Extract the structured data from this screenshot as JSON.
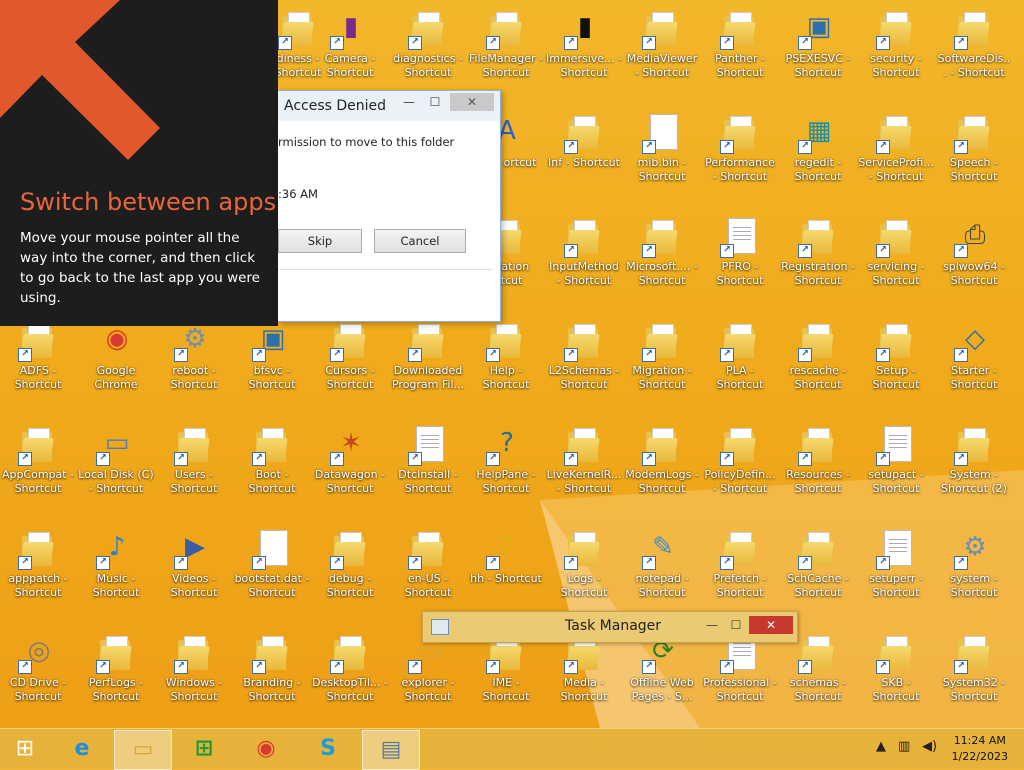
{
  "tip": {
    "title": "Switch between apps",
    "body": "Move your mouse pointer all the way into the corner, and then click to go back to the last app you were using."
  },
  "dialog": {
    "title": "Access Denied",
    "message": "rmission to move to this folder",
    "time": ":36 AM",
    "skip_label": "Skip",
    "cancel_label": "Cancel",
    "min_glyph": "—",
    "max_glyph": "☐",
    "close_glyph": "✕"
  },
  "taskmgr": {
    "title": "Task Manager",
    "min_glyph": "—",
    "max_glyph": "☐",
    "close_glyph": "✕"
  },
  "desktop_icons": [
    {
      "label": "diness - Shortcut",
      "kind": "folder"
    },
    {
      "label": "Camera - Shortcut",
      "kind": "purpledoc"
    },
    {
      "label": "diagnostics - Shortcut",
      "kind": "folder"
    },
    {
      "label": "FileManager - Shortcut",
      "kind": "folder"
    },
    {
      "label": "Immersive... - Shortcut",
      "kind": "blackdoc"
    },
    {
      "label": "MediaViewer - Shortcut",
      "kind": "folder"
    },
    {
      "label": "Panther - Shortcut",
      "kind": "folder"
    },
    {
      "label": "PSEXESVC - Shortcut",
      "kind": "window"
    },
    {
      "label": "security - Shortcut",
      "kind": "folder"
    },
    {
      "label": "SoftwareDis... - Shortcut",
      "kind": "folder"
    },
    {
      "label": "nts - ortcut",
      "kind": "font"
    },
    {
      "label": "Inf - Shortcut",
      "kind": "folder"
    },
    {
      "label": "mib.bin - Shortcut",
      "kind": "doc"
    },
    {
      "label": "Performance - Shortcut",
      "kind": "folder"
    },
    {
      "label": "regedit - Shortcut",
      "kind": "regedit"
    },
    {
      "label": "ServiceProfi... - Shortcut",
      "kind": "folder"
    },
    {
      "label": "Speech - Shortcut",
      "kind": "folder"
    },
    {
      "label": "alization ortcut",
      "kind": "folder"
    },
    {
      "label": "InputMethod - Shortcut",
      "kind": "folder"
    },
    {
      "label": "Microsoft.... - Shortcut",
      "kind": "folder"
    },
    {
      "label": "PFRO - Shortcut",
      "kind": "textdoc"
    },
    {
      "label": "Registration - Shortcut",
      "kind": "folder"
    },
    {
      "label": "servicing - Shortcut",
      "kind": "folder"
    },
    {
      "label": "splwow64 - Shortcut",
      "kind": "printer"
    },
    {
      "label": "ADFS - Shortcut",
      "kind": "folder"
    },
    {
      "label": "Google Chrome",
      "kind": "chrome"
    },
    {
      "label": "reboot - Shortcut",
      "kind": "gear"
    },
    {
      "label": "bfsvc - Shortcut",
      "kind": "window"
    },
    {
      "label": "Cursors - Shortcut",
      "kind": "folder"
    },
    {
      "label": "Downloaded Program Fil...",
      "kind": "folder"
    },
    {
      "label": "Help - Shortcut",
      "kind": "folder"
    },
    {
      "label": "L2Schemas - Shortcut",
      "kind": "folder"
    },
    {
      "label": "Migration - Shortcut",
      "kind": "folder"
    },
    {
      "label": "PLA - Shortcut",
      "kind": "folder"
    },
    {
      "label": "rescache - Shortcut",
      "kind": "folder"
    },
    {
      "label": "Setup - Shortcut",
      "kind": "folder"
    },
    {
      "label": "Starter - Shortcut",
      "kind": "xmldoc"
    },
    {
      "label": "AppCompat - Shortcut",
      "kind": "folder"
    },
    {
      "label": "Local Disk (C) - Shortcut",
      "kind": "drive"
    },
    {
      "label": "Users - Shortcut",
      "kind": "folder"
    },
    {
      "label": "Boot - Shortcut",
      "kind": "folder"
    },
    {
      "label": "Datawagon - Shortcut",
      "kind": "datawagon"
    },
    {
      "label": "DtcInstall - Shortcut",
      "kind": "textdoc"
    },
    {
      "label": "HelpPane - Shortcut",
      "kind": "help"
    },
    {
      "label": "LiveKernelR... - Shortcut",
      "kind": "folder"
    },
    {
      "label": "ModemLogs - Shortcut",
      "kind": "folder"
    },
    {
      "label": "PolicyDefin... - Shortcut",
      "kind": "folder"
    },
    {
      "label": "Resources - Shortcut",
      "kind": "folder"
    },
    {
      "label": "setupact - Shortcut",
      "kind": "textdoc"
    },
    {
      "label": "System - Shortcut (2)",
      "kind": "folder"
    },
    {
      "label": "apppatch - Shortcut",
      "kind": "folder"
    },
    {
      "label": "Music - Shortcut",
      "kind": "music"
    },
    {
      "label": "Videos - Shortcut",
      "kind": "video"
    },
    {
      "label": "bootstat.dat - Shortcut",
      "kind": "doc"
    },
    {
      "label": "debug - Shortcut",
      "kind": "folder"
    },
    {
      "label": "en-US - Shortcut",
      "kind": "folder"
    },
    {
      "label": "hh - Shortcut",
      "kind": "hh"
    },
    {
      "label": "Logs - Shortcut",
      "kind": "folder"
    },
    {
      "label": "notepad - Shortcut",
      "kind": "notepad"
    },
    {
      "label": "Prefetch - Shortcut",
      "kind": "folder"
    },
    {
      "label": "SchCache - Shortcut",
      "kind": "folder"
    },
    {
      "label": "setuperr - Shortcut",
      "kind": "textdoc"
    },
    {
      "label": "system - Shortcut",
      "kind": "gear"
    },
    {
      "label": "CD Drive - Shortcut",
      "kind": "cd"
    },
    {
      "label": "PerfLogs - Shortcut",
      "kind": "folder"
    },
    {
      "label": "Windows - Shortcut",
      "kind": "folder"
    },
    {
      "label": "Branding - Shortcut",
      "kind": "folder"
    },
    {
      "label": "DesktopTil... - Shortcut",
      "kind": "folder"
    },
    {
      "label": "explorer - Shortcut",
      "kind": "explorer"
    },
    {
      "label": "IME - Shortcut",
      "kind": "folder"
    },
    {
      "label": "Media - Shortcut",
      "kind": "folder"
    },
    {
      "label": "Offline Web Pages - S...",
      "kind": "offline"
    },
    {
      "label": "Professional - Shortcut",
      "kind": "textdoc"
    },
    {
      "label": "schemas - Shortcut",
      "kind": "folder"
    },
    {
      "label": "SKB - Shortcut",
      "kind": "folder"
    },
    {
      "label": "System32 - Shortcut",
      "kind": "folder"
    }
  ],
  "taskbar": {
    "start_glyph": "⊞",
    "items": [
      {
        "name": "internet-explorer",
        "glyph": "e",
        "color": "#1e8fe0"
      },
      {
        "name": "file-explorer",
        "glyph": "▭",
        "color": "#d8a435"
      },
      {
        "name": "store",
        "glyph": "⊞",
        "color": "#1a9b3c"
      },
      {
        "name": "chrome",
        "glyph": "◉",
        "color": "#d93a2f"
      },
      {
        "name": "skype",
        "glyph": "S",
        "color": "#1a9ddb"
      },
      {
        "name": "task-manager",
        "glyph": "▤",
        "color": "#5a7aa0"
      }
    ],
    "tray": {
      "chevron": "▲",
      "network": "▥",
      "volume": "◀)"
    },
    "time": "11:24 AM",
    "date": "1/22/2023"
  }
}
